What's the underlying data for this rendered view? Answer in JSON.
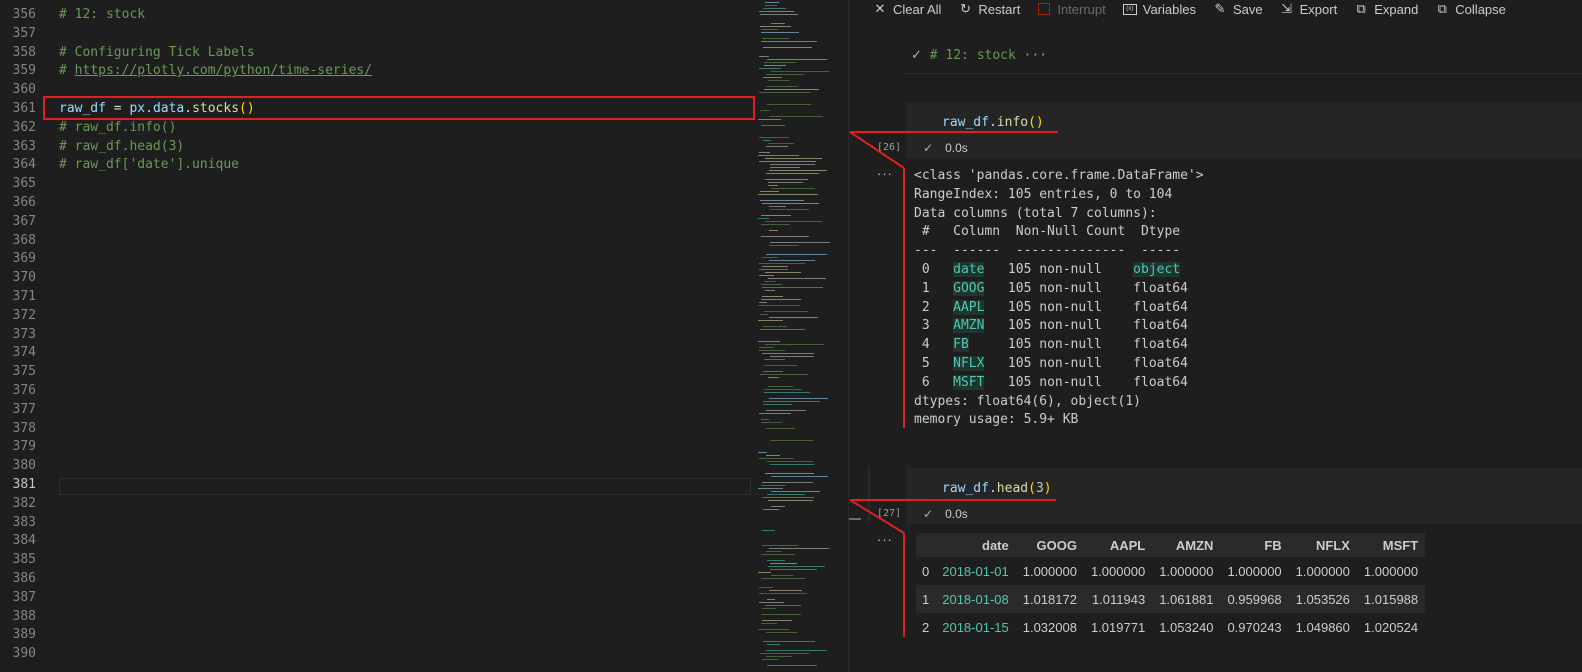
{
  "editor": {
    "line_numbers": [
      "356",
      "357",
      "358",
      "359",
      "360",
      "361",
      "362",
      "363",
      "364",
      "365",
      "366",
      "367",
      "368",
      "369",
      "370",
      "371",
      "372",
      "373",
      "374",
      "375",
      "376",
      "377",
      "378",
      "379",
      "380",
      "381",
      "382",
      "383",
      "384",
      "385",
      "386",
      "387",
      "388",
      "389",
      "390"
    ],
    "active_line": "381",
    "line_356": "# 12: stock",
    "line_358": "# Configuring Tick Labels",
    "line_359_prefix": "# ",
    "line_359_url": "https://plotly.com/python/time-series/",
    "line_361_var": "raw_df",
    "line_361_op": " = ",
    "line_361_mod": "px",
    "line_361_dot1": ".",
    "line_361_data": "data",
    "line_361_dot2": ".",
    "line_361_fn": "stocks",
    "line_361_par": "()",
    "line_362": "# raw_df.info()",
    "line_363": "# raw_df.head(3)",
    "line_364": "# raw_df['date'].unique"
  },
  "toolbar": {
    "clear_all": "Clear All",
    "restart": "Restart",
    "interrupt": "Interrupt",
    "variables": "Variables",
    "save": "Save",
    "export": "Export",
    "expand": "Expand",
    "collapse": "Collapse"
  },
  "notebook": {
    "collapsed_cell": "# 12: stock",
    "collapsed_ellipsis": "···",
    "cell1": {
      "var": "raw_df",
      "dot": ".",
      "fn": "info",
      "par": "()",
      "exec_count": "[26]",
      "time": "0.0s",
      "output_ellipsis": "···",
      "output_lines": [
        "<class 'pandas.core.frame.DataFrame'>",
        "RangeIndex: 105 entries, 0 to 104",
        "Data columns (total 7 columns):",
        " #   Column  Non-Null Count  Dtype",
        "---  ------  --------------  -----"
      ],
      "rows": [
        {
          "idx": " 0   ",
          "col": "date",
          "count": "   105 non-null    ",
          "dtype": "object"
        },
        {
          "idx": " 1   ",
          "col": "GOOG",
          "count": "   105 non-null    ",
          "dtype": "float64"
        },
        {
          "idx": " 2   ",
          "col": "AAPL",
          "count": "   105 non-null    ",
          "dtype": "float64"
        },
        {
          "idx": " 3   ",
          "col": "AMZN",
          "count": "   105 non-null    ",
          "dtype": "float64"
        },
        {
          "idx": " 4   ",
          "col": "FB",
          "count": "     105 non-null    ",
          "dtype": "float64"
        },
        {
          "idx": " 5   ",
          "col": "NFLX",
          "count": "   105 non-null    ",
          "dtype": "float64"
        },
        {
          "idx": " 6   ",
          "col": "MSFT",
          "count": "   105 non-null    ",
          "dtype": "float64"
        }
      ],
      "footer_lines": [
        "dtypes: float64(6), object(1)",
        "memory usage: 5.9+ KB"
      ]
    },
    "cell2": {
      "var": "raw_df",
      "dot": ".",
      "fn": "head",
      "par_open": "(",
      "arg": "3",
      "par_close": ")",
      "exec_count": "[27]",
      "time": "0.0s",
      "output_ellipsis": "···",
      "table": {
        "headers": [
          "",
          "date",
          "GOOG",
          "AAPL",
          "AMZN",
          "FB",
          "NFLX",
          "MSFT"
        ],
        "rows": [
          [
            "0",
            "2018-01-01",
            "1.000000",
            "1.000000",
            "1.000000",
            "1.000000",
            "1.000000",
            "1.000000"
          ],
          [
            "1",
            "2018-01-08",
            "1.018172",
            "1.011943",
            "1.061881",
            "0.959968",
            "1.053526",
            "1.015988"
          ],
          [
            "2",
            "2018-01-15",
            "1.032008",
            "1.019771",
            "1.053240",
            "0.970243",
            "1.049860",
            "1.020524"
          ]
        ]
      }
    }
  },
  "colors": {
    "annotation_red": "#e0201e",
    "comment": "#6a9955",
    "teal": "#4ec9b0"
  }
}
